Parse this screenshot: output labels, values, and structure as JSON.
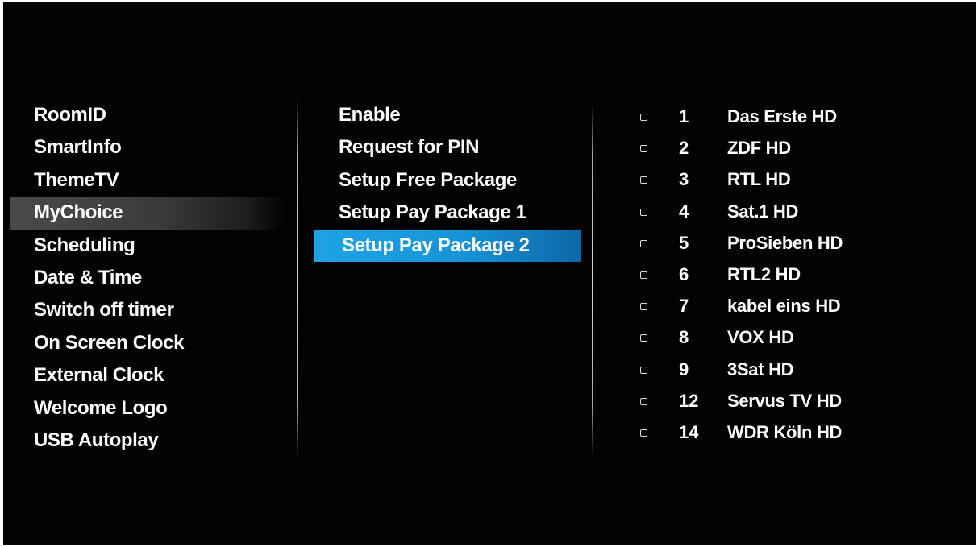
{
  "left_menu": {
    "items": [
      {
        "label": "RoomID",
        "selected": false
      },
      {
        "label": "SmartInfo",
        "selected": false
      },
      {
        "label": "ThemeTV",
        "selected": false
      },
      {
        "label": "MyChoice",
        "selected": true
      },
      {
        "label": "Scheduling",
        "selected": false
      },
      {
        "label": "Date & Time",
        "selected": false
      },
      {
        "label": "Switch off timer",
        "selected": false
      },
      {
        "label": "On Screen Clock",
        "selected": false
      },
      {
        "label": "External Clock",
        "selected": false
      },
      {
        "label": "Welcome Logo",
        "selected": false
      },
      {
        "label": "USB Autoplay",
        "selected": false
      }
    ]
  },
  "mid_menu": {
    "items": [
      {
        "label": "Enable",
        "selected": false
      },
      {
        "label": "Request for PIN",
        "selected": false
      },
      {
        "label": "Setup Free Package",
        "selected": false
      },
      {
        "label": "Setup Pay Package 1",
        "selected": false
      },
      {
        "label": "Setup Pay Package 2",
        "selected": true
      }
    ]
  },
  "channel_list": {
    "channels": [
      {
        "number": "1",
        "name": "Das Erste HD",
        "checked": false
      },
      {
        "number": "2",
        "name": "ZDF HD",
        "checked": false
      },
      {
        "number": "3",
        "name": "RTL HD",
        "checked": false
      },
      {
        "number": "4",
        "name": "Sat.1 HD",
        "checked": false
      },
      {
        "number": "5",
        "name": "ProSieben HD",
        "checked": false
      },
      {
        "number": "6",
        "name": "RTL2 HD",
        "checked": false
      },
      {
        "number": "7",
        "name": "kabel eins HD",
        "checked": false
      },
      {
        "number": "8",
        "name": "VOX HD",
        "checked": false
      },
      {
        "number": "9",
        "name": "3Sat HD",
        "checked": false
      },
      {
        "number": "12",
        "name": "Servus TV HD",
        "checked": false
      },
      {
        "number": "14",
        "name": "WDR Köln HD",
        "checked": false
      }
    ]
  },
  "colors": {
    "background": "#020202",
    "text": "#ffffff",
    "highlight_blue": "#1ea3e6",
    "highlight_gray": "#4a4a4a"
  }
}
